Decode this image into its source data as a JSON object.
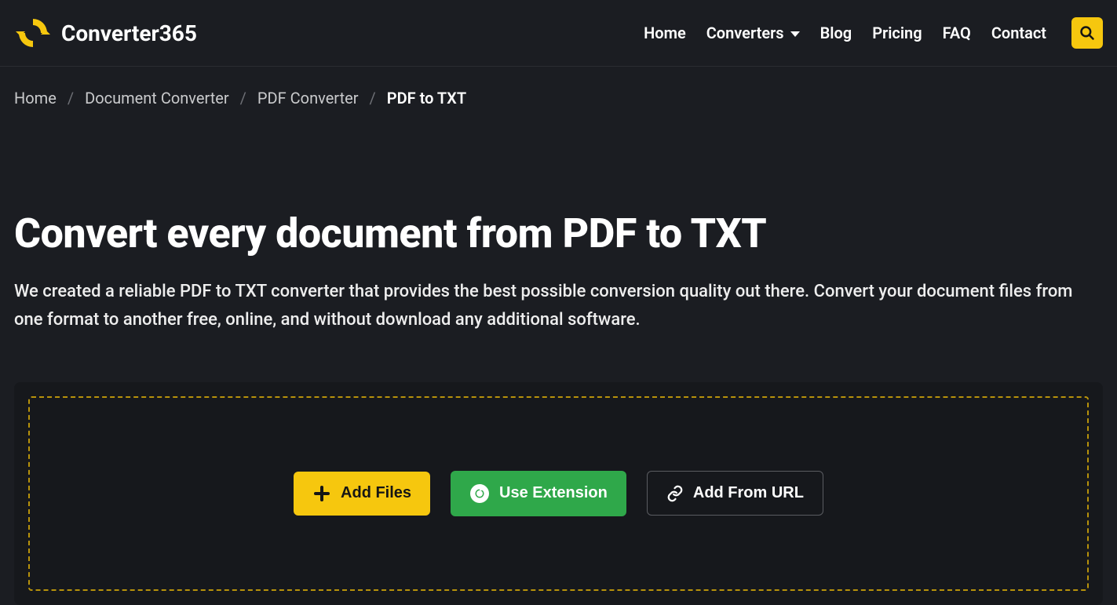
{
  "brand": {
    "name": "Converter365"
  },
  "nav": {
    "home": "Home",
    "converters": "Converters",
    "blog": "Blog",
    "pricing": "Pricing",
    "faq": "FAQ",
    "contact": "Contact"
  },
  "breadcrumb": {
    "home": "Home",
    "doc_converter": "Document Converter",
    "pdf_converter": "PDF Converter",
    "current": "PDF to TXT"
  },
  "hero": {
    "title": "Convert every document from PDF to TXT",
    "subtitle": "We created a reliable PDF to TXT converter that provides the best possible conversion quality out there. Convert your document files from one format to another free, online, and without download any additional software."
  },
  "buttons": {
    "add_files": "Add Files",
    "use_extension": "Use Extension",
    "add_from_url": "Add From URL"
  },
  "colors": {
    "accent": "#f6c70e",
    "green": "#2fa84a",
    "bg": "#1b1d22",
    "panel": "#16181c"
  }
}
